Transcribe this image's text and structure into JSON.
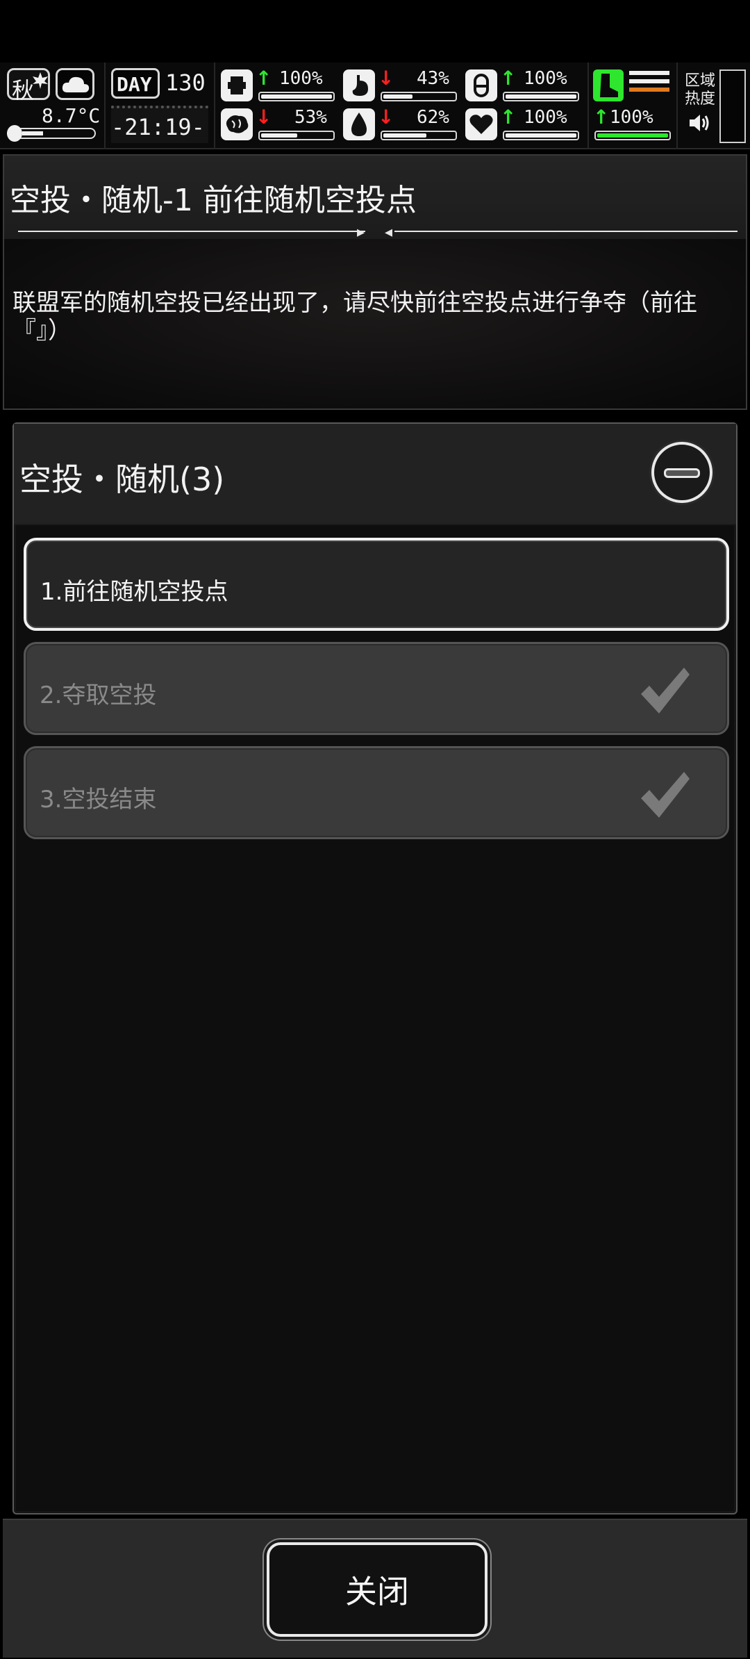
{
  "hud": {
    "season": "秋",
    "temperature": "8.7°C",
    "day_label": "DAY",
    "day_number": "130",
    "time": "-21:19-",
    "stats": [
      {
        "id": "health",
        "icon": "first-aid-kit-icon",
        "trend": "up",
        "value": "100%",
        "level": 1.0
      },
      {
        "id": "hunger",
        "icon": "stomach-icon",
        "trend": "down",
        "value": "43%",
        "level": 0.43
      },
      {
        "id": "medicine",
        "icon": "pill-icon",
        "trend": "up",
        "value": "100%",
        "level": 1.0
      },
      {
        "id": "sanity",
        "icon": "brain-icon",
        "trend": "down",
        "value": "53%",
        "level": 0.53
      },
      {
        "id": "thirst",
        "icon": "water-drop-icon",
        "trend": "down",
        "value": "62%",
        "level": 0.62
      },
      {
        "id": "mood",
        "icon": "heart-icon",
        "trend": "up",
        "value": "100%",
        "level": 1.0
      }
    ],
    "stamina": {
      "icon": "boot-icon",
      "trend": "up",
      "value": "100%",
      "level": 1.0
    },
    "zone_heat_label": "区域热度"
  },
  "quest": {
    "title": "空投・随机-1 前往随机空投点",
    "description": "联盟军的随机空投已经出现了，请尽快前往空投点进行争夺（前往『』）"
  },
  "steps_panel": {
    "title": "空投・随机(3)",
    "steps": [
      {
        "label": "1.前往随机空投点",
        "state": "active"
      },
      {
        "label": "2.夺取空投",
        "state": "done"
      },
      {
        "label": "3.空投结束",
        "state": "done"
      }
    ]
  },
  "footer": {
    "close_label": "关闭"
  }
}
